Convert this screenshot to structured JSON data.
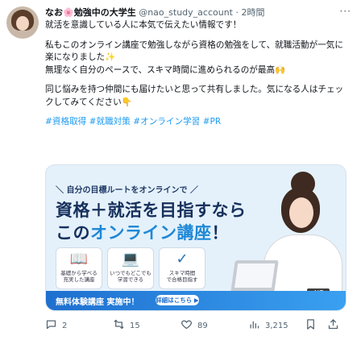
{
  "post": {
    "name": "なお🌸勉強中の大学生",
    "handle": "@nao_study_account",
    "dot": "·",
    "time": "2時間",
    "more": "···",
    "paragraphs": [
      "就活を意識している人に本気で伝えたい情報です！",
      "私もこのオンライン講座で勉強しながら資格の勉強をして、就職活動が一気に楽になりました✨\n無理なく自分のペースで、スキマ時間に進められるのが最高🙌",
      "同じ悩みを持つ仲間にも届けたいと思って共有しました。気になる人はチェックしてみてください👇"
    ],
    "tags": "#資格取得 #就職対策 #オンライン学習 #PR"
  },
  "card": {
    "title_line": "＼ 自分の目標ルートをオンラインで ／",
    "big1": "資格＋就活を目指すなら",
    "big2_pre": "この",
    "big2_accent": "オンライン講座",
    "big2_post": "！",
    "features": [
      {
        "icon": "📖",
        "label": "基礎から学べる\n充実した講座"
      },
      {
        "icon": "💻",
        "label": "いつでもどこでも\n学習できる"
      },
      {
        "icon": "✓",
        "label": "スキマ時間\nで合格目指す"
      }
    ],
    "footer_text": "無料体験講座 実施中！",
    "footer_badge": "詳細はこちら ▶",
    "alt_badge": "ALT"
  },
  "actions": {
    "reply": "2",
    "retweet": "15",
    "like": "89",
    "views": "3,215",
    "reply_icon": "reply-icon",
    "retweet_icon": "retweet-icon",
    "like_icon": "heart-icon",
    "views_icon": "views-icon",
    "bookmark_icon": "bookmark-icon",
    "share_icon": "share-icon"
  }
}
